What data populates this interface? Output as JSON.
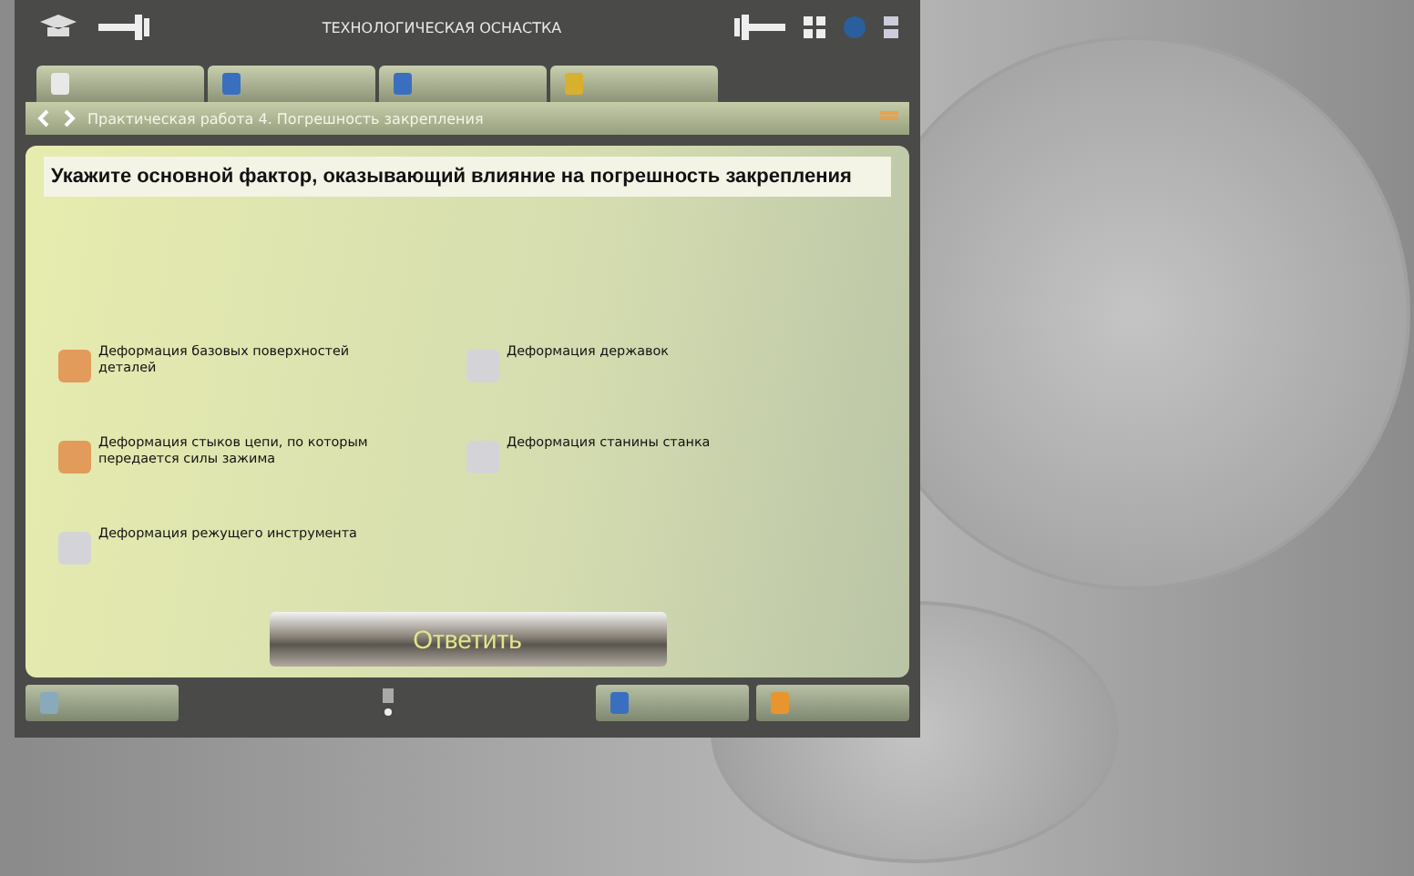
{
  "window": {
    "title": "ТЕХНОЛОГИЧЕСКАЯ ОСНАСТКА"
  },
  "tabs": [
    {
      "selected": false
    },
    {
      "selected": false
    },
    {
      "selected": false
    },
    {
      "selected": false
    }
  ],
  "breadcrumb": "Практическая работа 4. Погрешность закрепления",
  "question": "Укажите основной фактор, оказывающий влияние на погрешность закрепления",
  "options": [
    {
      "label": "Деформация базовых поверхностей деталей",
      "checked": true
    },
    {
      "label": "Деформация державок",
      "checked": false
    },
    {
      "label": "Деформация стыков цепи, по которым передается силы зажима",
      "checked": true
    },
    {
      "label": "Деформация станины станка",
      "checked": false
    },
    {
      "label": "Деформация  режущего инструмента",
      "checked": false
    }
  ],
  "answer_button": "Ответить"
}
